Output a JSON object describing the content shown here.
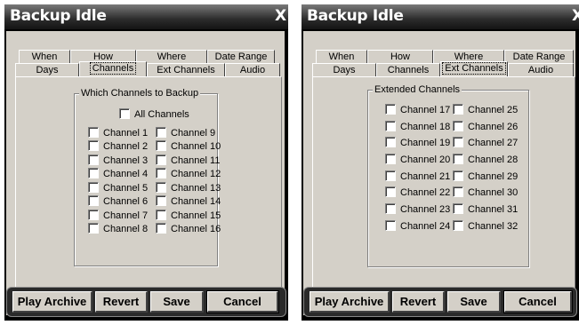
{
  "left": {
    "title": "Backup Idle",
    "close": "X",
    "tabs_top": [
      "When",
      "How",
      "Where",
      "Date Range"
    ],
    "tabs_bottom": [
      "Days",
      "Channels",
      "Ext Channels",
      "Audio"
    ],
    "selected_tab": "Channels",
    "group_label": "Which Channels to Backup",
    "all_channels": "All Channels",
    "channels_col1": [
      "Channel 1",
      "Channel 2",
      "Channel 3",
      "Channel 4",
      "Channel 5",
      "Channel 6",
      "Channel 7",
      "Channel 8"
    ],
    "channels_col2": [
      "Channel 9",
      "Channel 10",
      "Channel 11",
      "Channel 12",
      "Channel 13",
      "Channel 14",
      "Channel 15",
      "Channel 16"
    ],
    "buttons": [
      "Play Archive",
      "Revert",
      "Save",
      "Cancel"
    ]
  },
  "right": {
    "title": "Backup Idle",
    "close": "X",
    "tabs_top": [
      "When",
      "How",
      "Where",
      "Date Range"
    ],
    "tabs_bottom": [
      "Days",
      "Channels",
      "Ext Channels",
      "Audio"
    ],
    "selected_tab": "Ext Channels",
    "group_label": "Extended Channels",
    "channels_col1": [
      "Channel 17",
      "Channel 18",
      "Channel 19",
      "Channel 20",
      "Channel 21",
      "Channel 22",
      "Channel 23",
      "Channel 24"
    ],
    "channels_col2": [
      "Channel 25",
      "Channel 26",
      "Channel 27",
      "Channel 28",
      "Channel 29",
      "Channel 30",
      "Channel 31",
      "Channel 32"
    ],
    "buttons": [
      "Play Archive",
      "Revert",
      "Save",
      "Cancel"
    ]
  }
}
